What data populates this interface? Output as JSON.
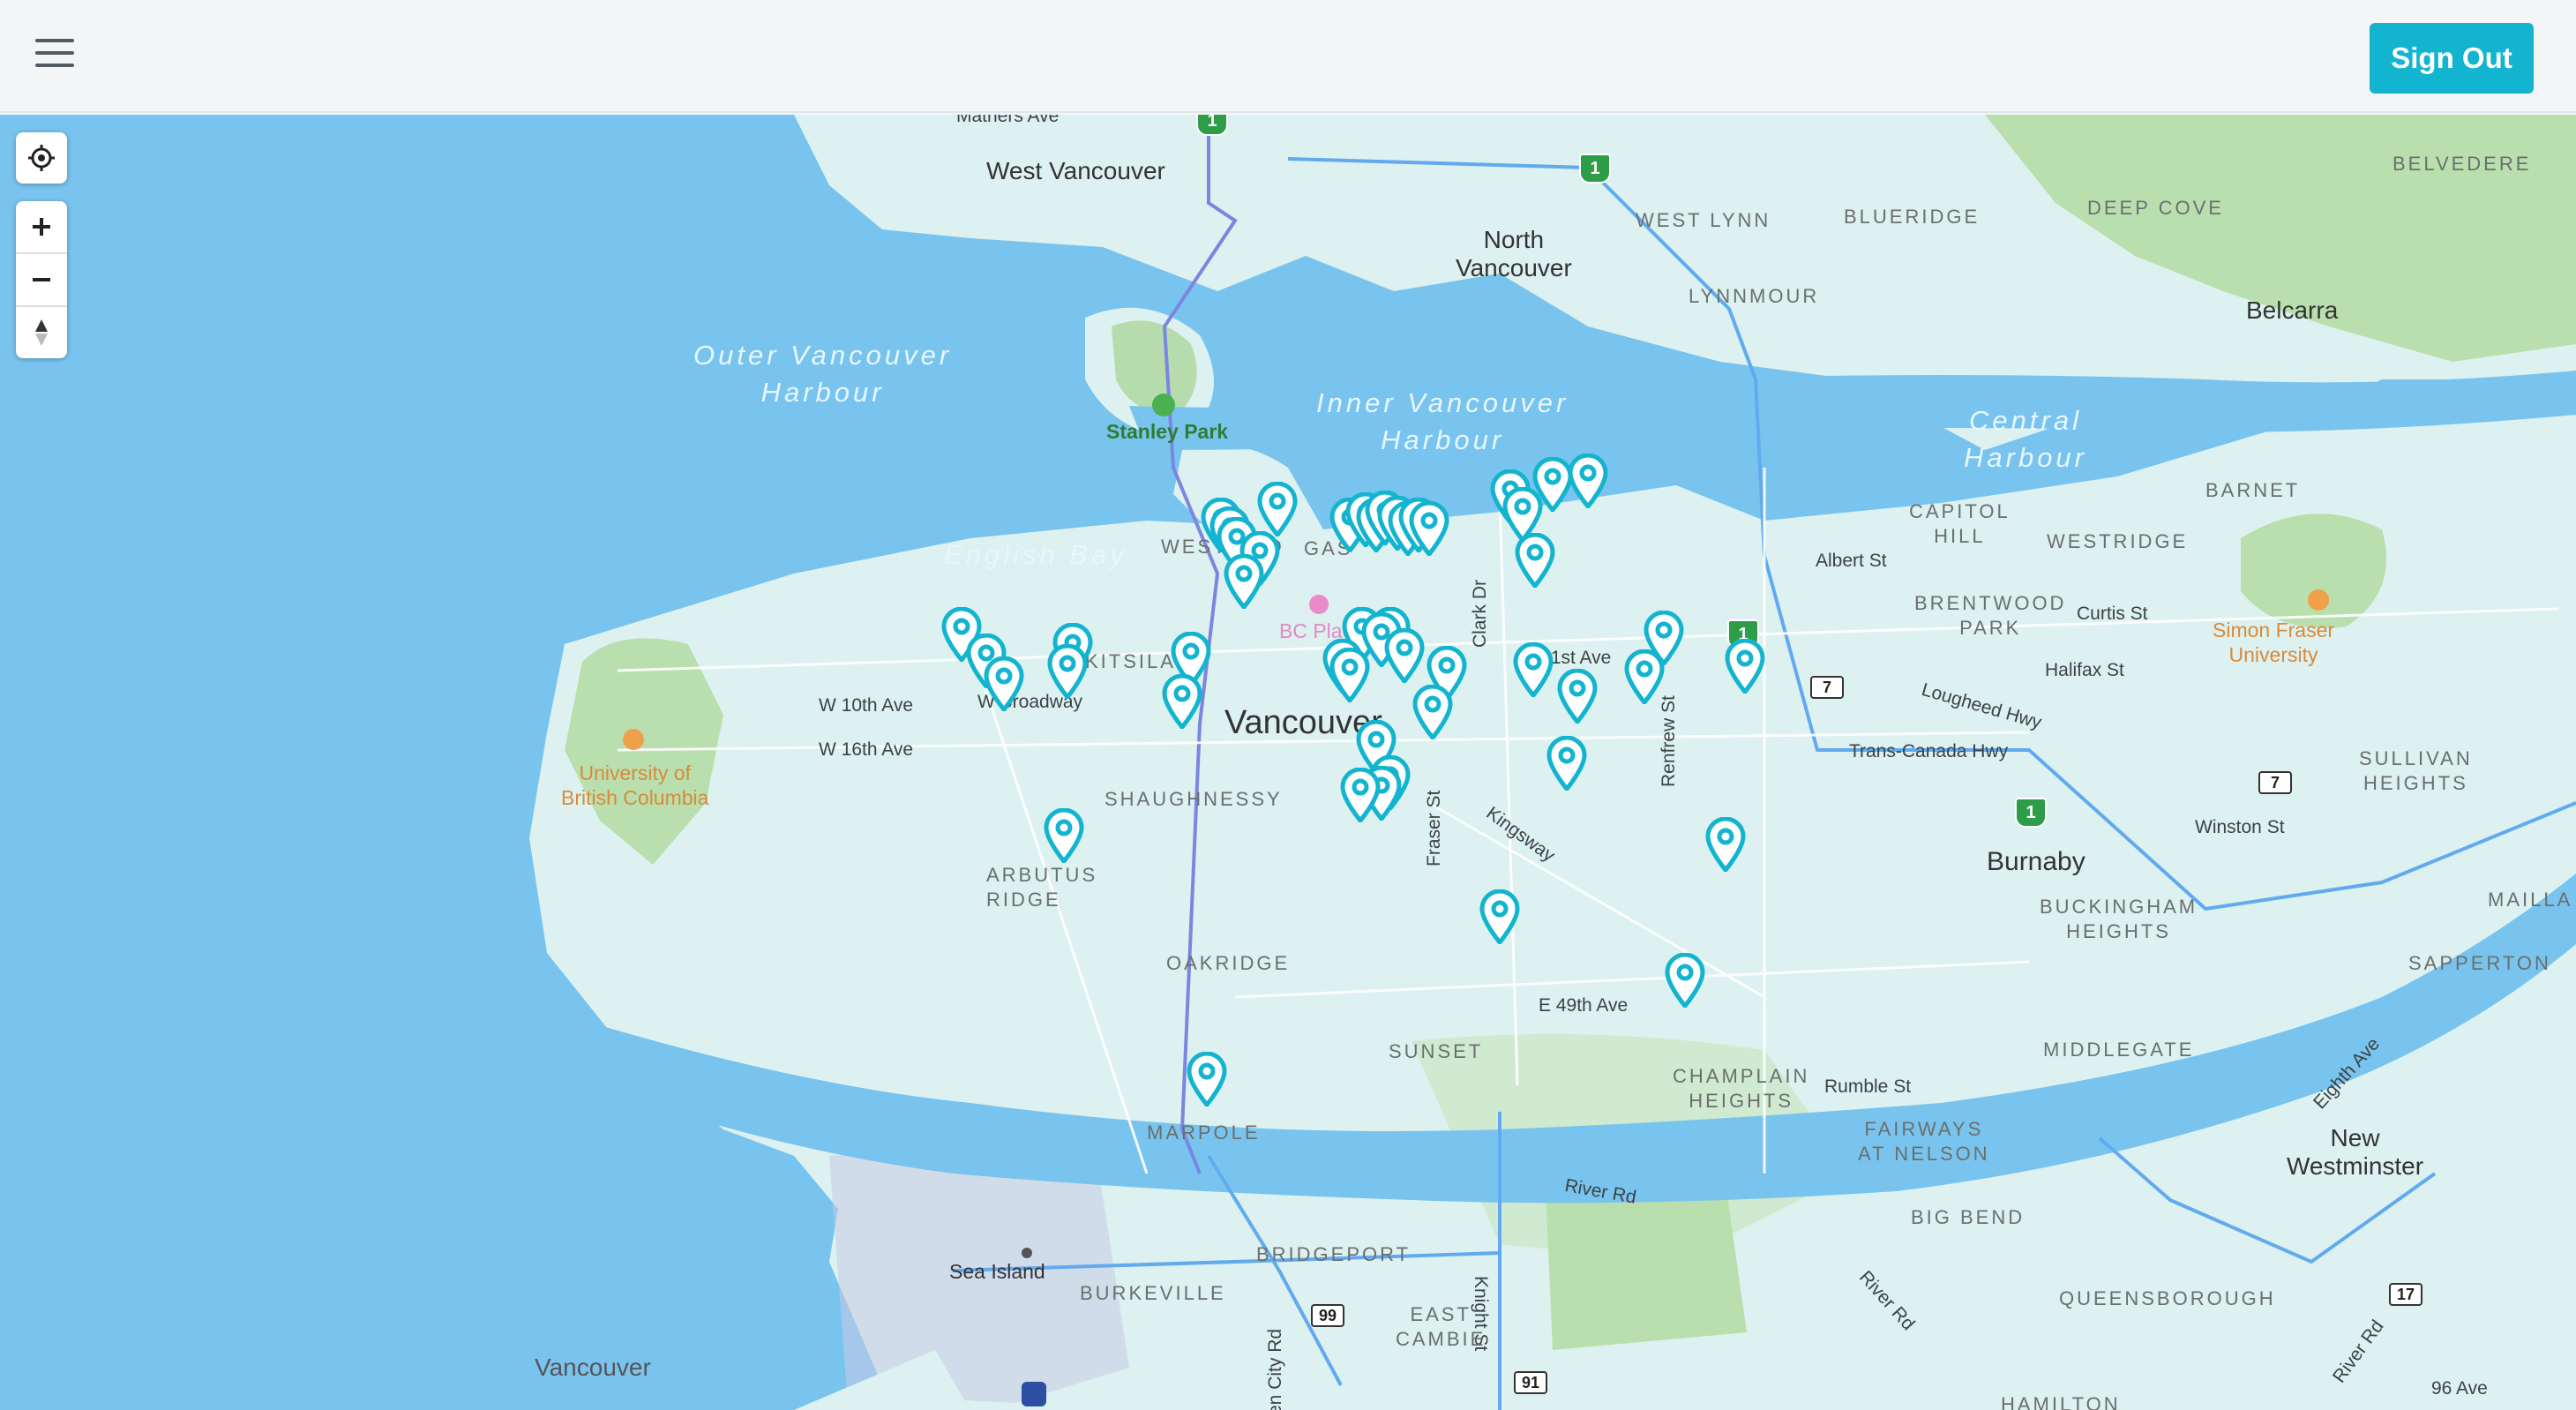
{
  "header": {
    "menu_icon": "hamburger-menu-icon",
    "sign_out_label": "Sign Out"
  },
  "map_controls": {
    "locate_icon": "crosshair-locate-icon",
    "zoom_in_icon": "plus-icon",
    "zoom_out_icon": "minus-icon",
    "compass_icon": "compass-arrow-icon"
  },
  "colors": {
    "accent": "#13b4cf",
    "water": "#79c4ee",
    "land": "#dcf1f0",
    "park": "#a8d5a2",
    "highway": "#1a9e4a",
    "marker": "#13b4cf"
  },
  "labels": {
    "mathers_ave": "Mathers Ave",
    "west_vancouver": "West Vancouver",
    "north_vancouver": "North\nVancouver",
    "west_lynn": "WEST LYNN",
    "blueridge": "BLUERIDGE",
    "deep_cove": "DEEP COVE",
    "belvedere": "BELVEDERE",
    "lynnmour": "LYNNMOUR",
    "belcarra": "Belcarra",
    "outer_harbour": "Outer Vancouver\nHarbour",
    "inner_harbour": "Inner Vancouver\nHarbour",
    "central_harbour": "Central\nHarbour",
    "stanley_park": "Stanley Park",
    "english_bay": "English Bay",
    "west_end": "WEST END",
    "gastown": "GAS",
    "barnet": "BARNET",
    "capitol_hill": "CAPITOL\nHILL",
    "westridge": "WESTRIDGE",
    "albert_st": "Albert St",
    "brentwood_park": "BRENTWOOD\nPARK",
    "curtis_st": "Curtis St",
    "sfu": "Simon Fraser\nUniversity",
    "bc_place": "BC Place",
    "kitsilano": "KITSILANO",
    "e_1st_ave": "E 1st Ave",
    "halifax_st": "Halifax St",
    "clark_dr": "Clark Dr",
    "broadway": "W Broadway",
    "w_10th_ave": "W 10th Ave",
    "w_16th_ave": "W 16th Ave",
    "vancouver": "Vancouver",
    "renfrew_st": "Renfrew St",
    "lougheed_hwy": "Lougheed Hwy",
    "trans_canada_hwy": "Trans-Canada Hwy",
    "sullivan_heights": "SULLIVAN\nHEIGHTS",
    "ubc": "University of\nBritish Columbia",
    "shaughnessy": "SHAUGHNESSY",
    "fraser_st": "Fraser St",
    "kingsway": "Kingsway",
    "winston_st": "Winston St",
    "burnaby": "Burnaby",
    "arbutus_ridge": "ARBUTUS\nRIDGE",
    "buckingham_heights": "BUCKINGHAM\nHEIGHTS",
    "mailla": "MAILLA",
    "sapperton": "SAPPERTON",
    "oakridge": "OAKRIDGE",
    "e_49th_ave": "E 49th Ave",
    "sunset": "SUNSET",
    "middlegate": "MIDDLEGATE",
    "eighth_ave": "Eighth Ave",
    "champlain_heights": "CHAMPLAIN\nHEIGHTS",
    "rumble_st": "Rumble St",
    "marpole": "MARPOLE",
    "fairways": "FAIRWAYS\nAT NELSON",
    "new_westminster": "New\nWestminster",
    "river_rd": "River Rd",
    "big_bend": "BIG BEND",
    "sea_island": "Sea Island",
    "bridgeport": "BRIDGEPORT",
    "burkeville": "BURKEVILLE",
    "knight_st": "Knight St",
    "river_rd_2": "River Rd",
    "queensborough": "QUEENSBOROUGH",
    "east_cambie": "EAST\nCAMBIE",
    "vancouver_airport": "Vancouver",
    "river_rd_3": "River Rd",
    "ave_96": "96 Ave",
    "hamilton": "HAMILTON",
    "garden_city_rd": "en City Rd"
  },
  "route_shields": {
    "hwy1_a": "1",
    "hwy1_b": "1",
    "hwy1_c": "1",
    "hwy1_d": "1",
    "r7_a": "7",
    "r7_b": "7",
    "r99": "99",
    "r91": "91",
    "r17": "17"
  }
}
